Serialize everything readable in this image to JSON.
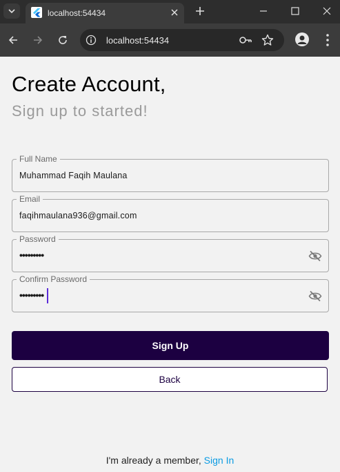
{
  "browser": {
    "tab_title": "localhost:54434",
    "url": "localhost:54434",
    "icons": {
      "tab_menu": "chevron-down-icon",
      "favicon": "flutter-icon",
      "tab_close": "close-icon",
      "new_tab": "plus-icon",
      "minimize": "minimize-icon",
      "maximize": "maximize-icon",
      "close": "close-icon",
      "back": "arrow-left-icon",
      "forward": "arrow-right-icon",
      "reload": "reload-icon",
      "site_info": "info-icon",
      "password": "key-icon",
      "bookmark": "star-icon",
      "profile": "person-icon",
      "menu": "kebab-icon"
    }
  },
  "page": {
    "title": "Create Account,",
    "subtitle": "Sign up to started!"
  },
  "form": {
    "full_name": {
      "label": "Full Name",
      "value": "Muhammad Faqih Maulana"
    },
    "email": {
      "label": "Email",
      "value": "faqihmaulana936@gmail.com"
    },
    "password": {
      "label": "Password",
      "value": "•••••••••"
    },
    "confirm_password": {
      "label": "Confirm Password",
      "value": "•••••••••"
    },
    "visibility_icon": "eye-off-icon"
  },
  "actions": {
    "sign_up": "Sign Up",
    "back": "Back"
  },
  "footer": {
    "prompt": "I'm already a member, ",
    "link": "Sign In"
  },
  "colors": {
    "primary": "#1c0041",
    "link": "#0a9be3",
    "background": "#f2f2f2",
    "caret": "#5b2bd8"
  }
}
